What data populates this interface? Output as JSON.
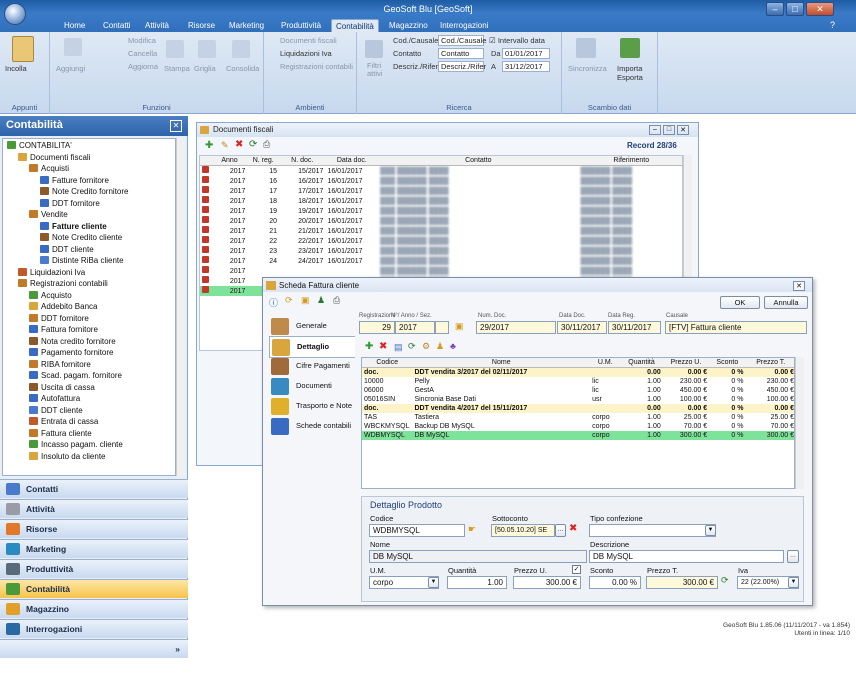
{
  "app_title": "GeoSoft Blu [GeoSoft]",
  "tabs": [
    "Home",
    "Contatti",
    "Attività",
    "Risorse",
    "Marketing",
    "Produttività",
    "Contabilità",
    "Magazzino",
    "Interrogazioni"
  ],
  "active_tab": "Contabilità",
  "ribbon": {
    "appunti": {
      "label": "Appunti",
      "incolla": "Incolla"
    },
    "funzioni": {
      "label": "Funzioni",
      "aggiungi": "Aggiungi",
      "modifica": "Modifica",
      "cancella": "Cancella",
      "aggiorna": "Aggiorna",
      "stampa": "Stampa",
      "griglia": "Griglia",
      "consolida": "Consolida"
    },
    "ambienti": {
      "label": "Ambienti",
      "documenti_fiscali": "Documenti fiscali",
      "liquidazioni_iva": "Liquidazioni Iva",
      "registrazioni_contabili": "Registrazioni contabili"
    },
    "ricerca": {
      "label": "Ricerca",
      "filtri_attivi": "Filtri attivi",
      "cod_causale_lbl": "Cod./Causale",
      "cod_causale_val": "Cod./Causale",
      "contatto_lbl": "Contatto",
      "contatto_val": "Contatto",
      "descriz_lbl": "Descriz./Rifer.",
      "descriz_val": "Descriz./Rifer",
      "intervallo_data": "Intervallo data",
      "da_lbl": "Da",
      "da_val": "01/01/2017",
      "a_lbl": "A",
      "a_val": "31/12/2017"
    },
    "scambio": {
      "label": "Scambio dati",
      "sincronizza": "Sincronizza",
      "importa": "Importa",
      "esporta": "Esporta"
    }
  },
  "left_panel": {
    "title": "Contabilità",
    "tree": [
      "CONTABILITA'",
      "Documenti fiscali",
      "Acquisti",
      "Fatture fornitore",
      "Note Credito fornitore",
      "DDT fornitore",
      "Vendite",
      "Fatture cliente",
      "Note Credito cliente",
      "DDT cliente",
      "Distinte RiBa cliente",
      "Liquidazioni Iva",
      "Registrazioni contabili",
      "Acquisto",
      "Addebito Banca",
      "DDT fornitore",
      "Fattura fornitore",
      "Nota credito fornitore",
      "Pagamento fornitore",
      "RIBA fornitore",
      "Scad. pagam. fornitore",
      "Uscita di cassa",
      "Autofattura",
      "DDT cliente",
      "Entrata di cassa",
      "Fattura cliente",
      "Incasso pagam. cliente",
      "Insoluto da cliente"
    ],
    "nav": [
      "Contatti",
      "Attività",
      "Risorse",
      "Marketing",
      "Produttività",
      "Contabilità",
      "Magazzino",
      "Interrogazioni"
    ]
  },
  "doc_window": {
    "title": "Documenti fiscali",
    "record": "Record 28/36",
    "columns": [
      "Anno",
      "N. reg.",
      "N. doc.",
      "Data doc.",
      "Contatto",
      "Riferimento"
    ],
    "rows": [
      [
        "2017",
        "15",
        "15/2017",
        "16/01/2017"
      ],
      [
        "2017",
        "16",
        "16/2017",
        "16/01/2017"
      ],
      [
        "2017",
        "17",
        "17/2017",
        "16/01/2017"
      ],
      [
        "2017",
        "18",
        "18/2017",
        "16/01/2017"
      ],
      [
        "2017",
        "19",
        "19/2017",
        "16/01/2017"
      ],
      [
        "2017",
        "20",
        "20/2017",
        "16/01/2017"
      ],
      [
        "2017",
        "21",
        "21/2017",
        "16/01/2017"
      ],
      [
        "2017",
        "22",
        "22/2017",
        "16/01/2017"
      ],
      [
        "2017",
        "23",
        "23/2017",
        "16/01/2017"
      ],
      [
        "2017",
        "24",
        "24/2017",
        "16/01/2017"
      ],
      [
        "2017",
        "",
        "",
        " "
      ],
      [
        "2017",
        "",
        "",
        " "
      ],
      [
        "2017",
        "",
        "",
        " "
      ]
    ]
  },
  "dialog": {
    "title": "Scheda Fattura cliente",
    "ok": "OK",
    "annulla": "Annulla",
    "sidebar": [
      "Generale",
      "Dettaglio",
      "Cifre Pagamenti",
      "Documenti",
      "Trasporto e Note",
      "Schede contabili"
    ],
    "header_labels": {
      "registrazione": "Registrazione",
      "n_anno_sez": "N°/ Anno / Sez.",
      "num_doc": "Num. Doc.",
      "data_doc": "Data Doc.",
      "data_reg": "Data Reg.",
      "causale": "Causale"
    },
    "header_values": {
      "registrazione": "29",
      "anno": "2017",
      "num_doc": "29/2017",
      "data_doc": "30/11/2017",
      "data_reg": "30/11/2017",
      "causale": "[FTV] Fattura cliente"
    },
    "columns": [
      "Codice",
      "Nome",
      "U.M.",
      "Quantità",
      "Prezzo U.",
      "Sconto",
      "Prezzo T."
    ],
    "rows": [
      {
        "c": "doc.",
        "n": "DDT vendita 3/2017 del 02/11/2017",
        "u": "",
        "q": "0.00",
        "p": "0.00 €",
        "s": "0 %",
        "t": "0.00 €",
        "type": "doc"
      },
      {
        "c": "10000",
        "n": "Pelly",
        "u": "lic",
        "q": "1.00",
        "p": "230.00 €",
        "s": "0 %",
        "t": "230.00 €"
      },
      {
        "c": "06000",
        "n": "GestA",
        "u": "lic",
        "q": "1.00",
        "p": "450.00 €",
        "s": "0 %",
        "t": "450.00 €"
      },
      {
        "c": "05016SIN",
        "n": "Sincronia Base Dati",
        "u": "usr",
        "q": "1.00",
        "p": "100.00 €",
        "s": "0 %",
        "t": "100.00 €"
      },
      {
        "c": "doc.",
        "n": "DDT vendita 4/2017 del 15/11/2017",
        "u": "",
        "q": "0.00",
        "p": "0.00 €",
        "s": "0 %",
        "t": "0.00 €",
        "type": "doc"
      },
      {
        "c": "TAS",
        "n": "Tastiera",
        "u": "corpo",
        "q": "1.00",
        "p": "25.00 €",
        "s": "0 %",
        "t": "25.00 €"
      },
      {
        "c": "WBCKMYSQL",
        "n": "Backup DB MySQL",
        "u": "corpo",
        "q": "1.00",
        "p": "70.00 €",
        "s": "0 %",
        "t": "70.00 €"
      },
      {
        "c": "WDBMYSQL",
        "n": "DB MySQL",
        "u": "corpo",
        "q": "1.00",
        "p": "300.00 €",
        "s": "0 %",
        "t": "300.00 €",
        "type": "sel"
      }
    ],
    "detail": {
      "title": "Dettaglio Prodotto",
      "codice_lbl": "Codice",
      "codice": "WDBMYSQL",
      "sottoconto_lbl": "Sottoconto",
      "sottoconto": "[50.05.10.20] SE",
      "tipo_lbl": "Tipo confezione",
      "tipo": "",
      "nome_lbl": "Nome",
      "nome": "DB MySQL",
      "descrizione_lbl": "Descrizione",
      "descrizione": "DB MySQL",
      "um_lbl": "U.M.",
      "um": "corpo",
      "quantita_lbl": "Quantità",
      "quantita": "1.00",
      "prezzo_u_lbl": "Prezzo U.",
      "prezzo_u": "300.00 €",
      "sconto_lbl": "Sconto",
      "sconto": "0.00 %",
      "prezzo_t_lbl": "Prezzo T.",
      "prezzo_t": "300.00 €",
      "iva_lbl": "Iva",
      "iva": "22 (22.00%)"
    }
  },
  "status": {
    "line1": "GeoSoft Blu 1.85.06 (11/11/2017 - va 1.854)",
    "line2": "Utenti in linea: 1/10"
  }
}
